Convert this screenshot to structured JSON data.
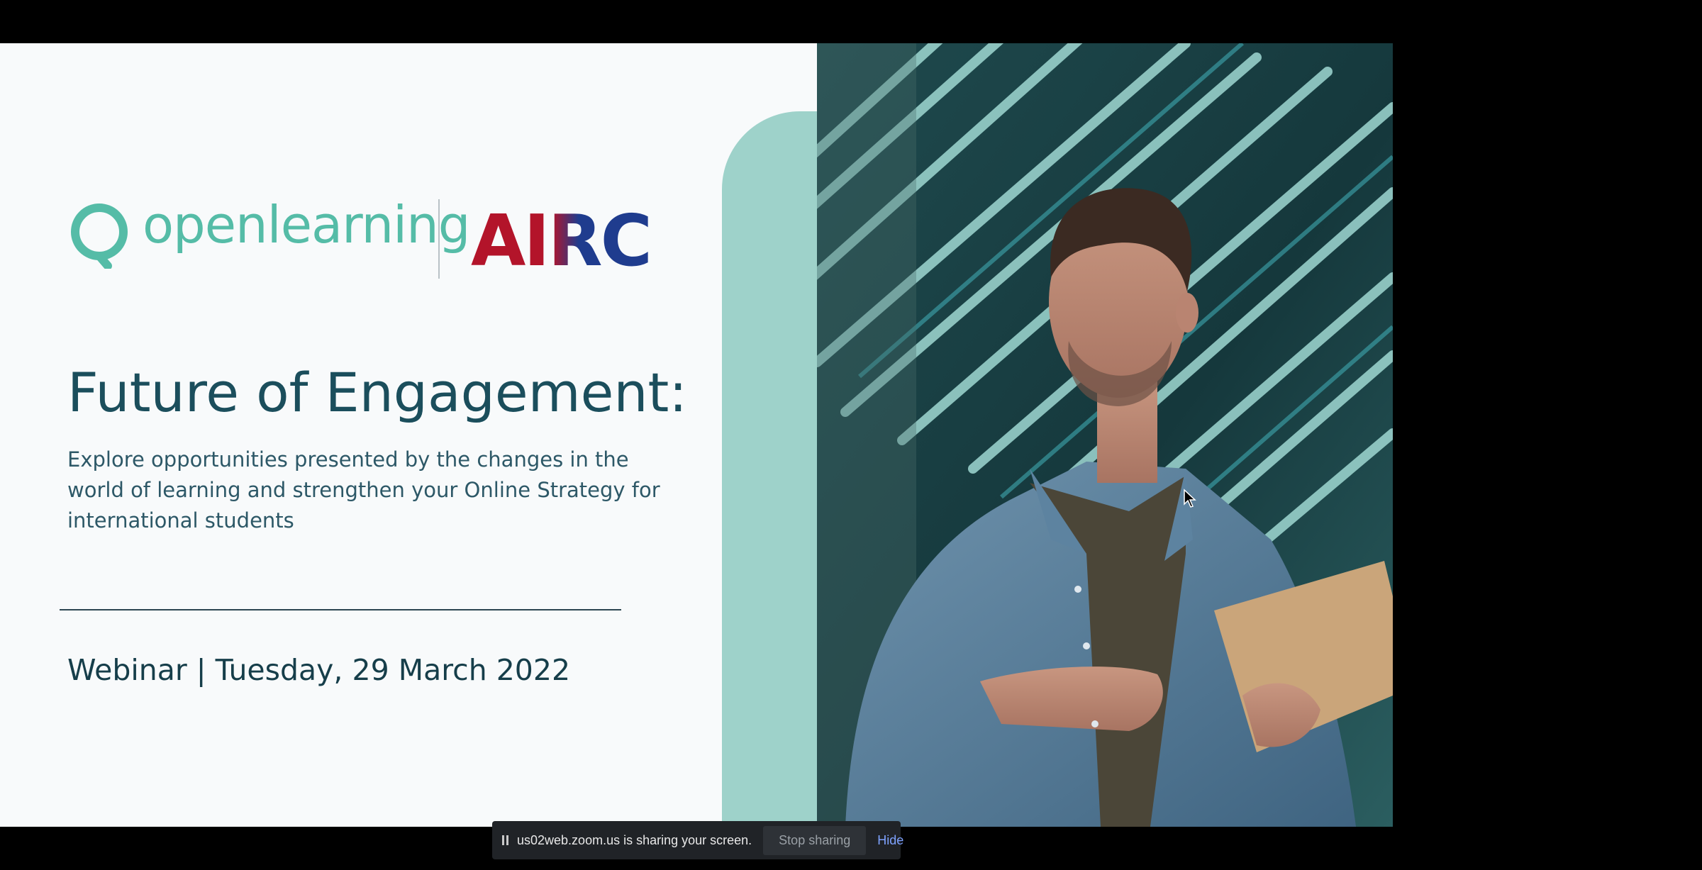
{
  "slide": {
    "logo_openlearning": "openlearning",
    "logo_airc": "AIRC",
    "title": "Future of Engagement:",
    "subtitle": "Explore opportunities presented by the changes in the world of learning and strengthen your Online Strategy for international students",
    "event_line": "Webinar | Tuesday, 29 March 2022"
  },
  "share_bar": {
    "message": "us02web.zoom.us is sharing your screen.",
    "stop_label": "Stop sharing",
    "hide_label": "Hide"
  },
  "icons": [
    "pause-icon",
    "openlearning-logo-icon",
    "cursor-icon"
  ],
  "colors": {
    "title": "#1b4e5c",
    "openlearning_teal": "#55bca7",
    "airc_red": "#b3142a",
    "airc_blue": "#1f3c8e",
    "panel_teal": "#9ed2ca"
  }
}
